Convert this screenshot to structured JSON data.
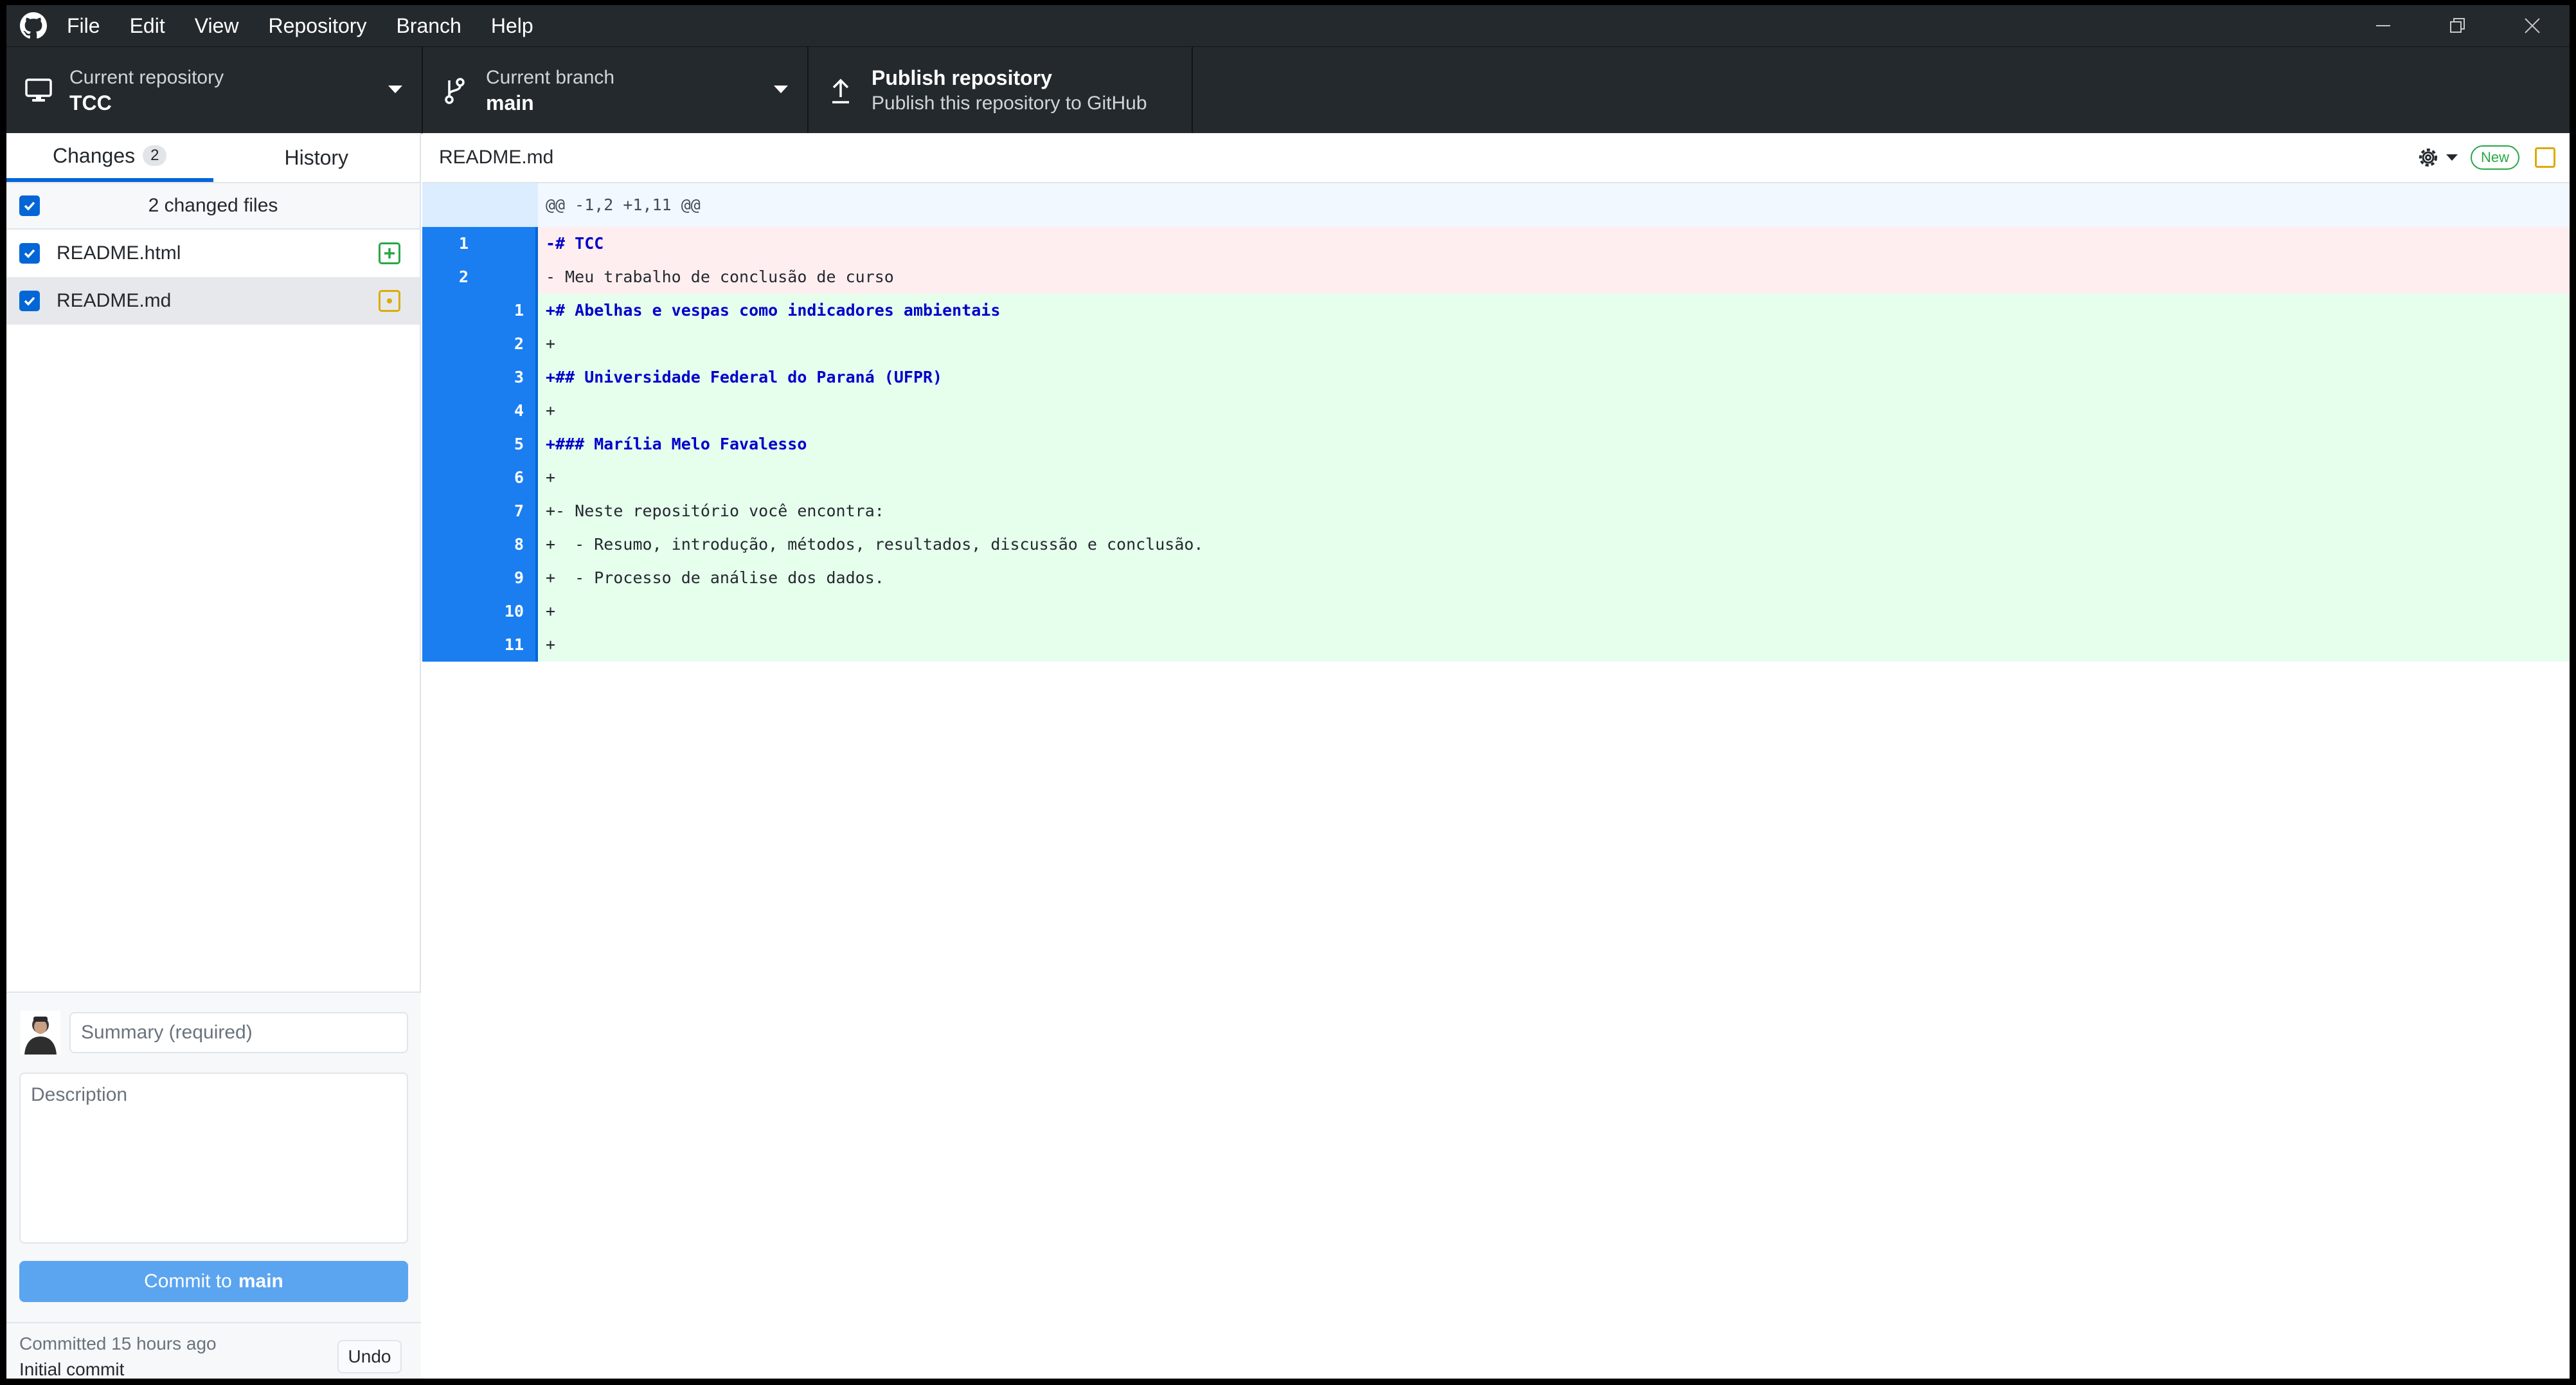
{
  "menu": [
    "File",
    "Edit",
    "View",
    "Repository",
    "Branch",
    "Help"
  ],
  "toolbar": {
    "repo_label": "Current repository",
    "repo_value": "TCC",
    "branch_label": "Current branch",
    "branch_value": "main",
    "publish_title": "Publish repository",
    "publish_sub": "Publish this repository to GitHub"
  },
  "tabs": {
    "changes": "Changes",
    "changes_count": "2",
    "history": "History"
  },
  "files": {
    "header": "2 changed files",
    "items": [
      {
        "name": "README.html",
        "status": "added"
      },
      {
        "name": "README.md",
        "status": "modified"
      }
    ]
  },
  "commit": {
    "summary_placeholder": "Summary (required)",
    "description_placeholder": "Description",
    "button_prefix": "Commit to",
    "button_branch": "main",
    "last_when": "Committed 15 hours ago",
    "last_message": "Initial commit",
    "undo": "Undo"
  },
  "diff": {
    "file": "README.md",
    "new_badge": "New",
    "hunk": "@@ -1,2 +1,11 @@",
    "lines": [
      {
        "type": "del",
        "old": "1",
        "new": "",
        "text": "-# TCC",
        "emph": true
      },
      {
        "type": "del",
        "old": "2",
        "new": "",
        "text": "- Meu trabalho de conclusão de curso",
        "emph": false
      },
      {
        "type": "add",
        "old": "",
        "new": "1",
        "text": "+# Abelhas e vespas como indicadores ambientais",
        "emph": true
      },
      {
        "type": "add",
        "old": "",
        "new": "2",
        "text": "+",
        "emph": false
      },
      {
        "type": "add",
        "old": "",
        "new": "3",
        "text": "+## Universidade Federal do Paraná (UFPR)",
        "emph": true
      },
      {
        "type": "add",
        "old": "",
        "new": "4",
        "text": "+",
        "emph": false
      },
      {
        "type": "add",
        "old": "",
        "new": "5",
        "text": "+### Marília Melo Favalesso",
        "emph": true
      },
      {
        "type": "add",
        "old": "",
        "new": "6",
        "text": "+",
        "emph": false
      },
      {
        "type": "add",
        "old": "",
        "new": "7",
        "text": "+- Neste repositório você encontra:",
        "emph": false
      },
      {
        "type": "add",
        "old": "",
        "new": "8",
        "text": "+  - Resumo, introdução, métodos, resultados, discussão e conclusão.",
        "emph": false
      },
      {
        "type": "add",
        "old": "",
        "new": "9",
        "text": "+  - Processo de análise dos dados.",
        "emph": false
      },
      {
        "type": "add",
        "old": "",
        "new": "10",
        "text": "+",
        "emph": false
      },
      {
        "type": "add",
        "old": "",
        "new": "11",
        "text": "+",
        "emph": false
      }
    ]
  },
  "colors": {
    "accent": "#0366d6",
    "added": "#28a745",
    "modified": "#dbab09",
    "titlebar": "#24292e"
  },
  "icons": [
    "github-logo-icon",
    "computer-icon",
    "branch-icon",
    "upload-icon",
    "gear-icon",
    "minimize-icon",
    "restore-icon",
    "close-icon"
  ]
}
